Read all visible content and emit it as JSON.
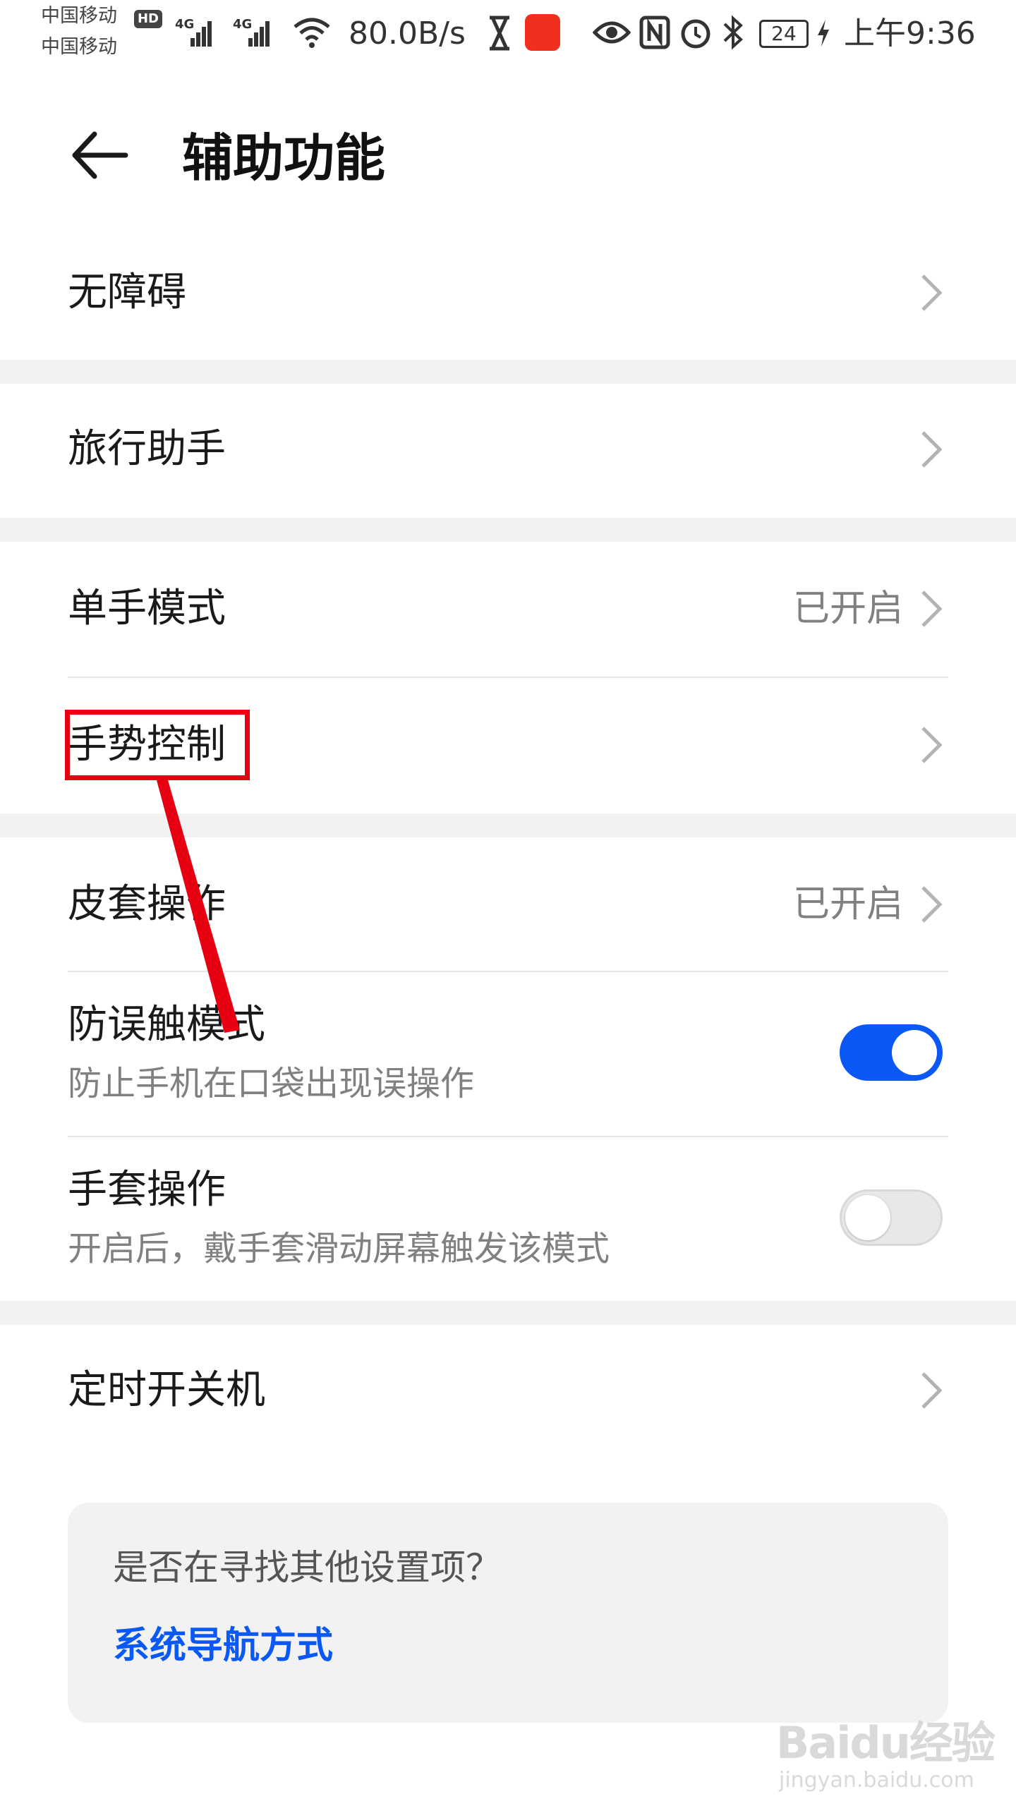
{
  "status_bar": {
    "carrier1": "中国移动",
    "carrier2": "中国移动",
    "hd": "HD",
    "net1": "4G",
    "net2": "4G",
    "speed": "80.0B/s",
    "battery": "24",
    "time": "上午9:36",
    "icons": [
      "signal-icon",
      "signal-icon",
      "wifi-icon",
      "hourglass-icon",
      "bank-app-icon",
      "eye-icon",
      "nfc-icon",
      "alarm-icon",
      "bluetooth-icon",
      "battery-icon",
      "charging-icon"
    ]
  },
  "header": {
    "title": "辅助功能",
    "back_icon": "arrow-left-icon"
  },
  "items": {
    "accessibility": {
      "label": "无障碍"
    },
    "travel": {
      "label": "旅行助手"
    },
    "one_hand": {
      "label": "单手模式",
      "value": "已开启"
    },
    "gesture": {
      "label": "手势控制"
    },
    "cover": {
      "label": "皮套操作",
      "value": "已开启"
    },
    "pocket": {
      "label": "防误触模式",
      "sub": "防止手机在口袋出现误操作",
      "toggle": true
    },
    "glove": {
      "label": "手套操作",
      "sub": "开启后，戴手套滑动屏幕触发该模式",
      "toggle": false
    },
    "schedule": {
      "label": "定时开关机"
    }
  },
  "card": {
    "question": "是否在寻找其他设置项？",
    "link": "系统导航方式"
  },
  "colors": {
    "accent": "#0a59f7",
    "annotation": "#e60012",
    "group_gap": "#f2f2f2"
  },
  "watermark": {
    "brand": "Baidu经验",
    "url": "jingyan.baidu.com"
  }
}
